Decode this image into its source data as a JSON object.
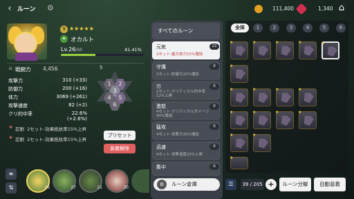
{
  "topbar": {
    "title": "ルーン",
    "back_icon": "‹",
    "gear_icon": "⚙",
    "gold": "111,400",
    "gem": "1,340",
    "home_icon": "⌂",
    "gold_color": "#e0a020",
    "gem_color": "#d03050"
  },
  "hero": {
    "badge": "9",
    "stars": "★★★★★",
    "element_icon": "✦",
    "name": "オカルト",
    "level": "Lv.26",
    "level_max": "/50",
    "xp_percent": "41.41%",
    "xp_fraction": 0.4141
  },
  "combat": {
    "label": "戦闘力",
    "value": "4,456"
  },
  "stats": [
    {
      "label": "攻撃力",
      "value": "310 (+33)"
    },
    {
      "label": "防御力",
      "value": "200 (+16)"
    },
    {
      "label": "体力",
      "value": "3069 (+261)"
    },
    {
      "label": "攻撃速度",
      "value": "82 (+2)"
    },
    {
      "label": "クリ的中率",
      "value": "22.6% (+2.6%)"
    }
  ],
  "sets": [
    {
      "name": "忍耐",
      "text": "2セット-効果抵抗率15%上昇"
    },
    {
      "name": "忍耐",
      "text": "2セット-効果抵抗率15%上昇"
    }
  ],
  "hex": {
    "top": "5",
    "slots": [
      "1",
      "2",
      "3",
      "4",
      "5",
      "6"
    ]
  },
  "buttons": {
    "preset": "プリセット",
    "unequip": "装着解除",
    "storage": "ルーン倉庫",
    "sell": "ルーン分解",
    "auto": "自動装着"
  },
  "heroes": [
    {
      "level": "26",
      "selected": true
    },
    {
      "level": "27"
    },
    {
      "level": "21"
    },
    {
      "level": "30"
    }
  ],
  "runes_list": {
    "header": "すべてのルーン",
    "items": [
      {
        "name": "元気",
        "desc": "2セット-最大体力15%増加",
        "count": "22",
        "active": true
      },
      {
        "name": "守護",
        "desc": "2セット-防御力15%増加",
        "count": "0"
      },
      {
        "name": "刃",
        "desc": "2セット-クリティカル的中率 12%上昇",
        "count": "0"
      },
      {
        "name": "激怒",
        "desc": "4セット-クリティカルダメージ 40%増加",
        "count": "0"
      },
      {
        "name": "猛攻",
        "desc": "4セット-攻撃力35%増加",
        "count": "0"
      },
      {
        "name": "迅速",
        "desc": "4セット-攻撃速度25%上昇",
        "count": "0"
      },
      {
        "name": "集中",
        "desc": "",
        "count": "0"
      }
    ]
  },
  "tabs": [
    "全体",
    "1",
    "2",
    "3",
    "4",
    "5",
    "6"
  ],
  "inventory_count": "39 / 205"
}
